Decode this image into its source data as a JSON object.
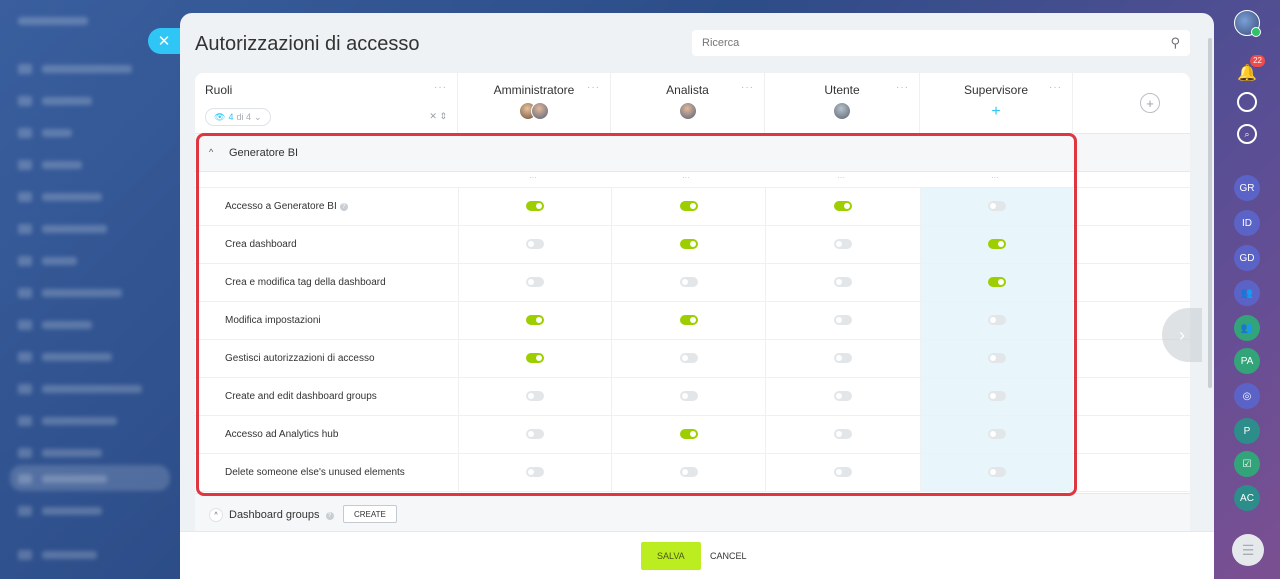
{
  "page": {
    "title": "Autorizzazioni di accesso",
    "search_placeholder": "Ricerca"
  },
  "table": {
    "roles_header": "Ruoli",
    "filter": {
      "count": "4",
      "of": "di 4"
    },
    "columns": [
      {
        "name": "Amministratore"
      },
      {
        "name": "Analista"
      },
      {
        "name": "Utente"
      },
      {
        "name": "Supervisore"
      }
    ],
    "section": {
      "title": "Generatore BI",
      "permissions": [
        {
          "label": "Accesso a Generatore BI",
          "values": [
            true,
            true,
            true,
            false
          ]
        },
        {
          "label": "Crea dashboard",
          "values": [
            false,
            true,
            false,
            true
          ]
        },
        {
          "label": "Crea e modifica tag della dashboard",
          "values": [
            false,
            false,
            false,
            true
          ]
        },
        {
          "label": "Modifica impostazioni",
          "values": [
            true,
            true,
            false,
            false
          ]
        },
        {
          "label": "Gestisci autorizzazioni di accesso",
          "values": [
            true,
            false,
            false,
            false
          ]
        },
        {
          "label": "Create and edit dashboard groups",
          "values": [
            false,
            false,
            false,
            false
          ]
        },
        {
          "label": "Accesso ad Analytics hub",
          "values": [
            false,
            true,
            false,
            false
          ]
        },
        {
          "label": "Delete someone else's unused elements",
          "values": [
            false,
            false,
            false,
            false
          ]
        }
      ]
    },
    "groups": {
      "title": "Dashboard groups",
      "create_label": "CREATE"
    }
  },
  "footer": {
    "save_label": "SALVA",
    "cancel_label": "CANCEL"
  },
  "right_sidebar": {
    "notification_count": "22",
    "items": [
      "GR",
      "ID",
      "GD",
      "",
      "",
      "PA",
      "",
      "P",
      "",
      "AC"
    ]
  },
  "colors": {
    "accent": "#2fc6f6",
    "toggle_on": "#9dcf00",
    "toggle_off": "#e3e6e9",
    "highlight_frame": "#e0363f",
    "save_button": "#bbed21"
  }
}
